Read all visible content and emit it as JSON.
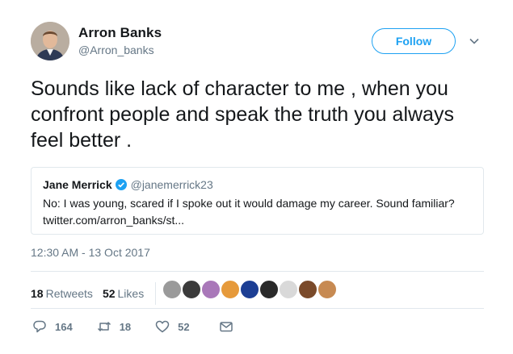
{
  "author": {
    "name": "Arron Banks",
    "handle": "@Arron_banks",
    "follow_label": "Follow"
  },
  "tweet": {
    "text": "Sounds like lack of character to me , when you confront people and speak the truth you always feel better .",
    "timestamp": "12:30 AM - 13 Oct 2017"
  },
  "quoted": {
    "name": "Jane Merrick",
    "handle": "@janemerrick23",
    "text": "No: I was young, scared if I spoke out it would damage my career. Sound familiar?",
    "link": "twitter.com/arron_banks/st..."
  },
  "stats": {
    "retweets_count": "18",
    "retweets_label": "Retweets",
    "likes_count": "52",
    "likes_label": "Likes"
  },
  "liker_avatars": [
    "#9a9a9a",
    "#3b3b3b",
    "#a978b9",
    "#e69a3a",
    "#1c3e94",
    "#2a2a2a",
    "#d9d9d9",
    "#7a4a2a",
    "#c78a52"
  ],
  "actions": {
    "reply_count": "164",
    "retweet_count": "18",
    "like_count": "52"
  },
  "colors": {
    "accent": "#1da1f2",
    "secondary_text": "#657786",
    "border": "#e1e8ed"
  }
}
